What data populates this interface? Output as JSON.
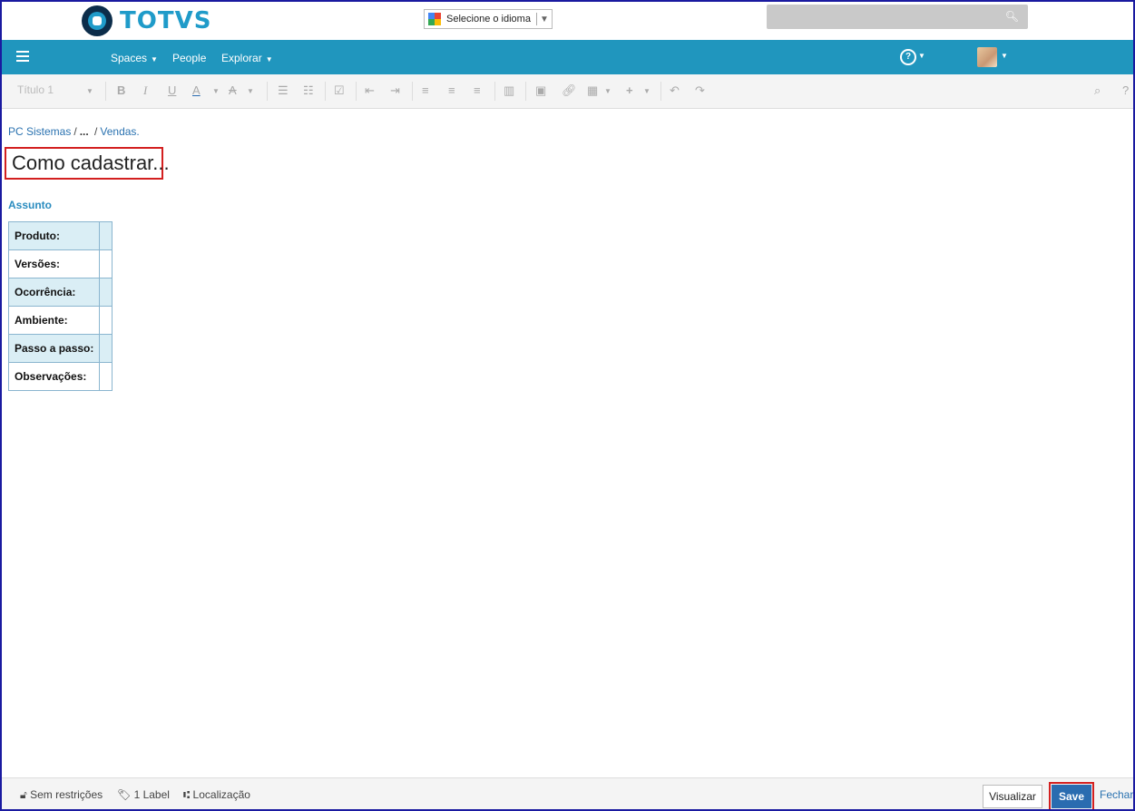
{
  "brand": {
    "logo_text": "TOTVS"
  },
  "language": {
    "label": "Selecione o idioma"
  },
  "nav": {
    "items": [
      {
        "label": "Spaces",
        "has_caret": true
      },
      {
        "label": "People",
        "has_caret": false
      },
      {
        "label": "Explorar",
        "has_caret": true
      }
    ],
    "help_symbol": "?"
  },
  "toolbar": {
    "heading_style": "Título 1",
    "tools": [
      "bold-icon",
      "italic-icon",
      "underline-icon",
      "text-color-icon",
      "clear-format-icon",
      "bullet-list-icon",
      "numbered-list-icon",
      "task-list-icon",
      "outdent-icon",
      "indent-icon",
      "align-left-icon",
      "align-center-icon",
      "align-right-icon",
      "layout-icon",
      "image-icon",
      "link-icon",
      "table-icon",
      "insert-icon",
      "undo-icon",
      "redo-icon",
      "search-icon",
      "help-icon"
    ]
  },
  "breadcrumb": {
    "root": "PC Sistemas",
    "ellipsis": "...",
    "current": "Vendas."
  },
  "page": {
    "title": "Como cadastrar...",
    "section_heading": "Assunto",
    "table_rows": [
      {
        "label": "Produto:",
        "value": ""
      },
      {
        "label": "Versões:",
        "value": ""
      },
      {
        "label": "Ocorrência:",
        "value": ""
      },
      {
        "label": "Ambiente:",
        "value": ""
      },
      {
        "label": "Passo a passo:",
        "value": ""
      },
      {
        "label": "Observações:",
        "value": ""
      }
    ]
  },
  "footer": {
    "restrictions": "Sem restrições",
    "labels": "1 Label",
    "location": "Localização",
    "preview_button": "Visualizar",
    "save_button": "Save",
    "close_link": "Fechar"
  },
  "colors": {
    "nav": "#2096be",
    "save": "#2a6cb0",
    "highlight": "#d32020",
    "link": "#2a72b0"
  }
}
